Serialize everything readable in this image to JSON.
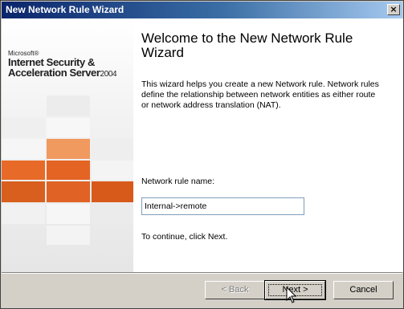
{
  "window": {
    "title": "New Network Rule Wizard",
    "close_glyph": "×"
  },
  "sidebar": {
    "brand": {
      "vendor": "Microsoft®",
      "line1": "Internet Security &",
      "line2": "Acceleration Server",
      "year": "2004"
    },
    "tile_colors": [
      "#f09a60",
      "#e86a28",
      "#d85f1e",
      "#f4f4f4",
      "#ececec"
    ]
  },
  "content": {
    "heading": "Welcome to the New Network Rule Wizard",
    "description": "This wizard helps you create a new Network rule. Network rules define the relationship between network entities as either route or network address translation (NAT).",
    "name_label": "Network rule name:",
    "name_value": "Internal->remote",
    "continue_text": "To continue, click Next."
  },
  "buttons": {
    "back": "< Back",
    "next": "Next >",
    "cancel": "Cancel"
  }
}
